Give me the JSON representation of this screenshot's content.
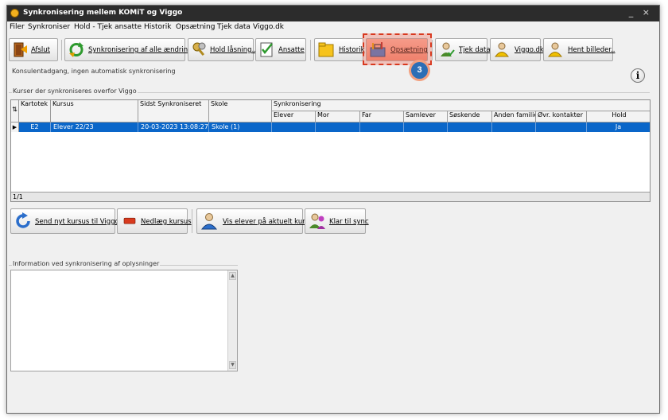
{
  "window": {
    "title": "Synkronisering mellem KOMiT og Viggo",
    "controls": "_ ×"
  },
  "menu": [
    "Filer",
    "Synkroniser",
    "Hold - Tjek ansatte",
    "Historik",
    "Opsætning",
    "Tjek data",
    "Viggo.dk"
  ],
  "toolbar": {
    "afslut": "Afslut",
    "sync_all": "Synkronisering af alle ændringer",
    "hold_laasning": "Hold låsning..",
    "ansatte": "Ansatte",
    "historik": "Historik",
    "opsaetning": "Opsætning",
    "tjek_data": "Tjek data",
    "viggo": "Viggo.dk",
    "hent_billeder": "Hent billeder.."
  },
  "callout": {
    "step": "3",
    "accent": "#d8391f"
  },
  "status_text": "Konsulentadgang, ingen automatisk synkronisering",
  "courses_group_label": "Kurser der synkroniseres overfor Viggo",
  "grid": {
    "columns": [
      "Kartotek",
      "Kursus",
      "Sidst Synkroniseret",
      "Skole"
    ],
    "sync_group_header": "Synkronisering",
    "sync_columns": [
      "Elever",
      "Mor",
      "Far",
      "Samlever",
      "Søskende",
      "Anden familie",
      "Øvr. kontakter",
      "Hold"
    ],
    "rows": [
      {
        "kartotek": "E2",
        "kursus": "Elever 22/23",
        "sidst": "20-03-2023 13:08:27",
        "skole": "Skole (1)",
        "hold": "Ja"
      }
    ],
    "footer": "1/1",
    "selected_color": "#0a66c9"
  },
  "actions": {
    "send": "Send nyt kursus til Viggo..",
    "nedlaeg": "Nedlæg kursus",
    "vis_elever": "Vis elever på aktuelt kursus",
    "klar": "Klar til sync"
  },
  "info_group_label": "Information ved synkronisering af oplysninger",
  "info_text": "",
  "info_icon": "i"
}
